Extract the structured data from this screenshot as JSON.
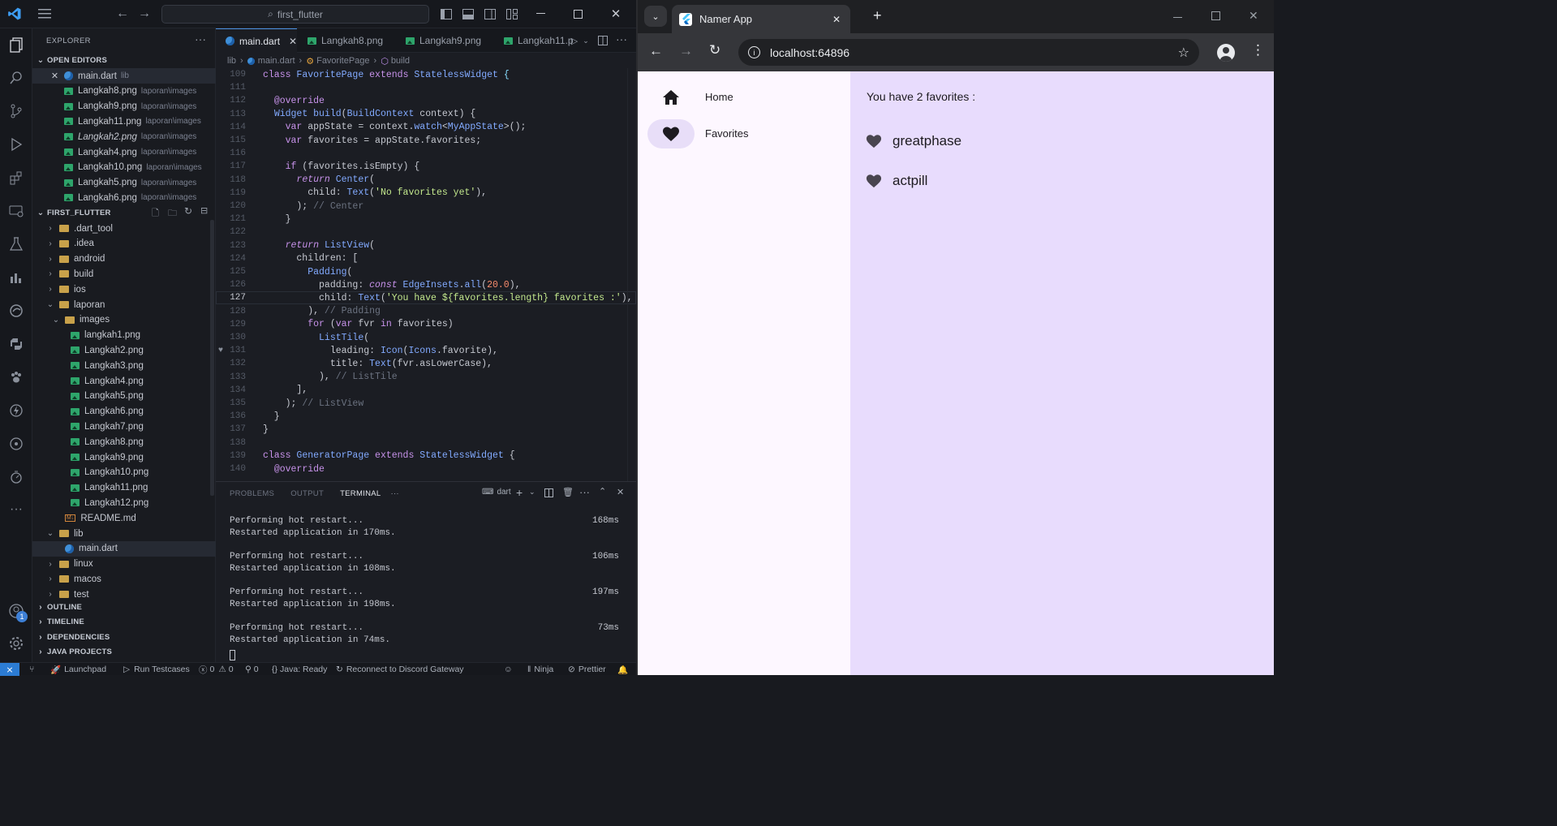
{
  "vscode": {
    "search_text": "first_flutter",
    "explorer_title": "EXPLORER",
    "open_editors_title": "OPEN EDITORS",
    "open_editors": [
      {
        "name": "main.dart",
        "desc": "lib",
        "type": "dart",
        "active": true
      },
      {
        "name": "Langkah8.png",
        "desc": "laporan\\images",
        "type": "img"
      },
      {
        "name": "Langkah9.png",
        "desc": "laporan\\images",
        "type": "img"
      },
      {
        "name": "Langkah11.png",
        "desc": "laporan\\images",
        "type": "img"
      },
      {
        "name": "Langkah2.png",
        "desc": "laporan\\images",
        "type": "img"
      },
      {
        "name": "Langkah4.png",
        "desc": "laporan\\images",
        "type": "img"
      },
      {
        "name": "Langkah10.png",
        "desc": "laporan\\images",
        "type": "img"
      },
      {
        "name": "Langkah5.png",
        "desc": "laporan\\images",
        "type": "img"
      },
      {
        "name": "Langkah6.png",
        "desc": "laporan\\images",
        "type": "img"
      }
    ],
    "project_title": "FIRST_FLUTTER",
    "tree": [
      {
        "name": ".dart_tool",
        "indent": 1,
        "type": "folder",
        "chev": "›"
      },
      {
        "name": ".idea",
        "indent": 1,
        "type": "folder",
        "chev": "›"
      },
      {
        "name": "android",
        "indent": 1,
        "type": "folder",
        "chev": "›"
      },
      {
        "name": "build",
        "indent": 1,
        "type": "folder",
        "chev": "›"
      },
      {
        "name": "ios",
        "indent": 1,
        "type": "folder",
        "chev": "›"
      },
      {
        "name": "laporan",
        "indent": 1,
        "type": "folder",
        "chev": "⌄"
      },
      {
        "name": "images",
        "indent": 2,
        "type": "folder",
        "chev": "⌄"
      },
      {
        "name": "langkah1.png",
        "indent": 3,
        "type": "img"
      },
      {
        "name": "Langkah2.png",
        "indent": 3,
        "type": "img"
      },
      {
        "name": "Langkah3.png",
        "indent": 3,
        "type": "img"
      },
      {
        "name": "Langkah4.png",
        "indent": 3,
        "type": "img"
      },
      {
        "name": "Langkah5.png",
        "indent": 3,
        "type": "img"
      },
      {
        "name": "Langkah6.png",
        "indent": 3,
        "type": "img"
      },
      {
        "name": "Langkah7.png",
        "indent": 3,
        "type": "img"
      },
      {
        "name": "Langkah8.png",
        "indent": 3,
        "type": "img"
      },
      {
        "name": "Langkah9.png",
        "indent": 3,
        "type": "img"
      },
      {
        "name": "Langkah10.png",
        "indent": 3,
        "type": "img"
      },
      {
        "name": "Langkah11.png",
        "indent": 3,
        "type": "img"
      },
      {
        "name": "Langkah12.png",
        "indent": 3,
        "type": "img"
      },
      {
        "name": "README.md",
        "indent": 2,
        "type": "md"
      },
      {
        "name": "lib",
        "indent": 1,
        "type": "folder",
        "chev": "⌄"
      },
      {
        "name": "main.dart",
        "indent": 2,
        "type": "dart",
        "selected": true
      },
      {
        "name": "linux",
        "indent": 1,
        "type": "folder",
        "chev": "›"
      },
      {
        "name": "macos",
        "indent": 1,
        "type": "folder",
        "chev": "›"
      },
      {
        "name": "test",
        "indent": 1,
        "type": "folder",
        "chev": "›"
      }
    ],
    "bottom_sections": [
      "OUTLINE",
      "TIMELINE",
      "DEPENDENCIES",
      "JAVA PROJECTS"
    ],
    "tabs": [
      "main.dart",
      "Langkah8.png",
      "Langkah9.png",
      "Langkah11.p"
    ],
    "breadcrumb": [
      "lib",
      "main.dart",
      "FavoritePage",
      "build"
    ],
    "code_lines": [
      {
        "n": "109",
        "html": "<span class='k'>class</span> <span class='t'>FavoritePage</span> <span class='k'>extends</span> <span class='t'>StatelessWidget</span> <span class='p'>{</span>"
      },
      {
        "n": "111",
        "html": ""
      },
      {
        "n": "112",
        "html": "  <span class='k'>@override</span>"
      },
      {
        "n": "113",
        "html": "  <span class='t'>Widget</span> <span class='f'>build</span>(<span class='t'>BuildContext</span> context) {"
      },
      {
        "n": "114",
        "html": "    <span class='k'>var</span> appState = context.<span class='f'>watch</span>&lt;<span class='t'>MyAppState</span>&gt;();"
      },
      {
        "n": "115",
        "html": "    <span class='k'>var</span> favorites = appState.favorites;"
      },
      {
        "n": "116",
        "html": ""
      },
      {
        "n": "117",
        "html": "    <span class='k'>if</span> (favorites.isEmpty) {"
      },
      {
        "n": "118",
        "html": "      <span class='it'>return</span> <span class='t'>Center</span>("
      },
      {
        "n": "119",
        "html": "        child: <span class='t'>Text</span>(<span class='s'>'No favorites yet'</span>),"
      },
      {
        "n": "120",
        "html": "      ); <span class='c'>// Center</span>"
      },
      {
        "n": "121",
        "html": "    }"
      },
      {
        "n": "122",
        "html": ""
      },
      {
        "n": "123",
        "html": "    <span class='it'>return</span> <span class='t'>ListView</span>("
      },
      {
        "n": "124",
        "html": "      children: ["
      },
      {
        "n": "125",
        "html": "        <span class='t'>Padding</span>("
      },
      {
        "n": "126",
        "html": "          padding: <span class='it'>const</span> <span class='t'>EdgeInsets</span>.<span class='f'>all</span>(<span class='n'>20.0</span>),"
      },
      {
        "n": "127",
        "html": "          child: <span class='t'>Text</span>(<span class='s'>'You have ${favorites.length} favorites :'</span>),",
        "cur": true
      },
      {
        "n": "128",
        "html": "        ), <span class='c'>// Padding</span>"
      },
      {
        "n": "129",
        "html": "        <span class='k'>for</span> (<span class='k'>var</span> fvr <span class='k'>in</span> favorites)"
      },
      {
        "n": "130",
        "html": "          <span class='t'>ListTile</span>("
      },
      {
        "n": "131",
        "html": "            leading: <span class='t'>Icon</span>(<span class='t'>Icons</span>.favorite),"
      },
      {
        "n": "132",
        "html": "            title: <span class='t'>Text</span>(fvr.asLowerCase),"
      },
      {
        "n": "133",
        "html": "          ), <span class='c'>// ListTile</span>"
      },
      {
        "n": "134",
        "html": "      ],"
      },
      {
        "n": "135",
        "html": "    ); <span class='c'>// ListView</span>"
      },
      {
        "n": "136",
        "html": "  }"
      },
      {
        "n": "137",
        "html": "}"
      },
      {
        "n": "138",
        "html": ""
      },
      {
        "n": "139",
        "html": "<span class='k'>class</span> <span class='t'>GeneratorPage</span> <span class='k'>extends</span> <span class='t'>StatelessWidget</span> {"
      },
      {
        "n": "140",
        "html": "  <span class='k'>@override</span>"
      }
    ],
    "panel_tabs": [
      "PROBLEMS",
      "OUTPUT",
      "TERMINAL"
    ],
    "terminal_name": "dart",
    "terminal": [
      {
        "a": "Performing hot restart...",
        "ms": "168ms",
        "b": "Restarted application in 170ms."
      },
      {
        "a": "Performing hot restart...",
        "ms": "106ms",
        "b": "Restarted application in 108ms."
      },
      {
        "a": "Performing hot restart...",
        "ms": "197ms",
        "b": "Restarted application in 198ms."
      },
      {
        "a": "Performing hot restart...",
        "ms": "73ms",
        "b": "Restarted application in 74ms."
      }
    ],
    "status": {
      "launchpad": "Launchpad",
      "testcases": "Run Testcases",
      "errors": "0",
      "warnings": "0",
      "ports": "0",
      "java": "Java: Ready",
      "discord": "Reconnect to Discord Gateway",
      "ninja": "Ninja",
      "prettier": "Prettier"
    },
    "badge": "1"
  },
  "browser": {
    "tab_title": "Namer App",
    "url": "localhost:64896",
    "nav": [
      {
        "label": "Home",
        "icon": "home-icon"
      },
      {
        "label": "Favorites",
        "icon": "heart-icon",
        "selected": true
      }
    ],
    "heading": "You have 2 favorites :",
    "favorites": [
      "greatphase",
      "actpill"
    ]
  }
}
